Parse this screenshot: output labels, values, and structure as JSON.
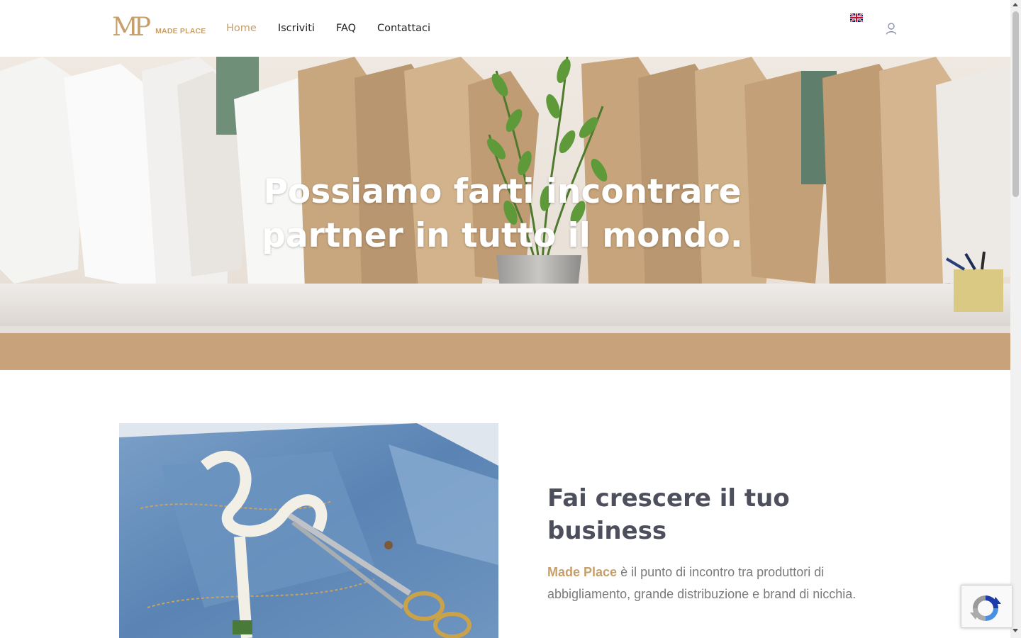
{
  "header": {
    "logo_mark": "MP",
    "logo_text": "MADE PLACE",
    "nav": [
      {
        "label": "Home",
        "active": true
      },
      {
        "label": "Iscriviti",
        "active": false
      },
      {
        "label": "FAQ",
        "active": false
      },
      {
        "label": "Contattaci",
        "active": false
      }
    ],
    "language_icon": "uk-flag-icon",
    "account_icon": "user-icon"
  },
  "hero": {
    "title_line1": "Possiamo farti incontrare",
    "title_line2": "partner in tutto il mondo."
  },
  "about": {
    "title_line1": "Fai crescere il tuo",
    "title_line2": "business",
    "brand": "Made Place",
    "text_rest": " è il punto di incontro tra produttori di abbigliamento, grande distribuzione e brand di nicchia."
  },
  "colors": {
    "accent": "#c69f6a",
    "heading": "#4d4f5c",
    "body_text": "#7a7a7a"
  },
  "widgets": {
    "recaptcha_icon": "recaptcha-icon"
  }
}
